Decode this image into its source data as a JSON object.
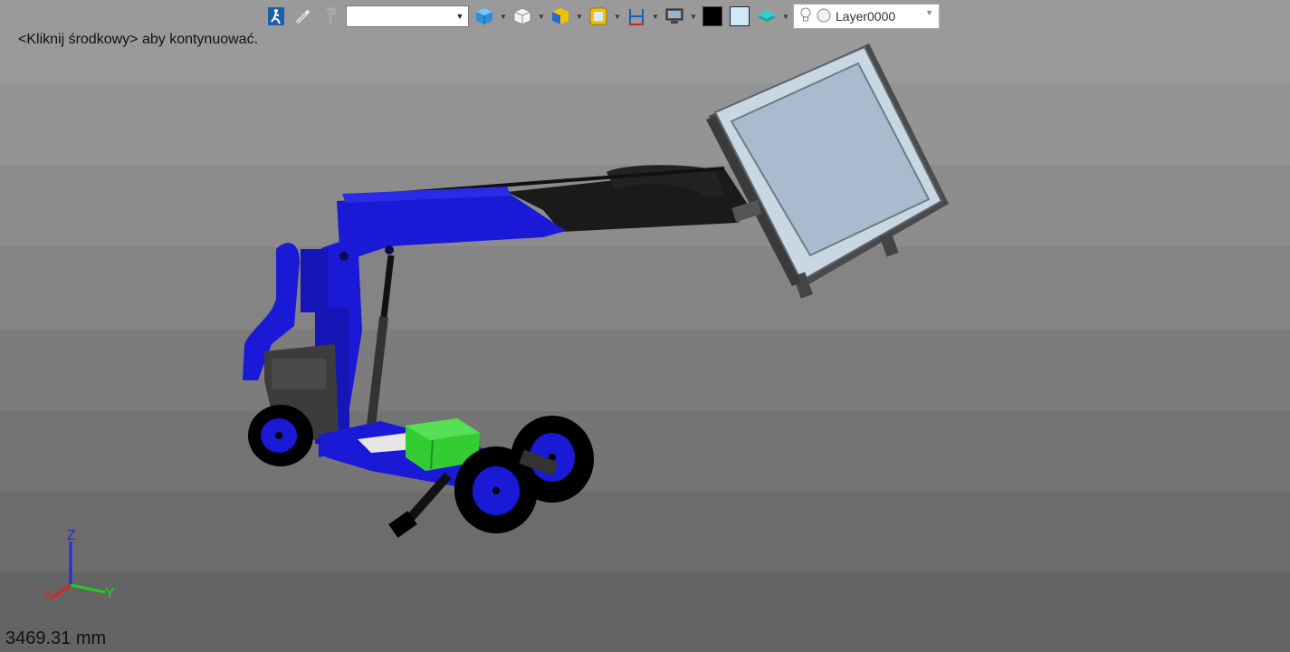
{
  "status": {
    "prompt": "<Kliknij środkowy> aby kontynuować."
  },
  "toolbar": {
    "view_combo_value": "",
    "icons": [
      "exit-icon",
      "probe-icon",
      "pin-icon",
      "view-cube-icon",
      "white-cube-icon",
      "section-cube-icon",
      "frame-icon",
      "dimension-icon",
      "display-monitor-icon",
      "color-swatch-black",
      "color-swatch-lightblue",
      "layer-stack-icon"
    ],
    "layer": {
      "name": "Layer0000"
    },
    "colors": {
      "swatch_black": "#000000",
      "swatch_lightblue": "#cfe9f7"
    }
  },
  "triad": {
    "x_label": "X",
    "y_label": "Y",
    "z_label": "Z"
  },
  "measure": {
    "value": "3469.31 mm"
  },
  "model": {
    "primary_color": "#1a1ad6",
    "accent_color": "#33cc33",
    "panel_color": "#a9bccd"
  }
}
